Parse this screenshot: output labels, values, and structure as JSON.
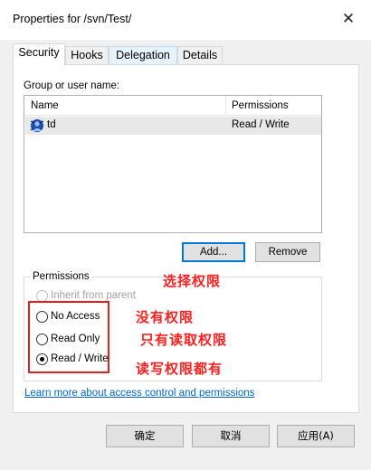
{
  "window": {
    "title": "Properties for /svn/Test/"
  },
  "tabs": [
    {
      "label": "Security"
    },
    {
      "label": "Hooks"
    },
    {
      "label": "Delegation"
    },
    {
      "label": "Details"
    }
  ],
  "security": {
    "group_label": "Group or user name:",
    "columns": [
      "Name",
      "Permissions"
    ],
    "rows": [
      {
        "name": "td",
        "permissions": "Read / Write"
      }
    ],
    "add_label": "Add...",
    "remove_label": "Remove",
    "permissions_legend": "Permissions",
    "radios": [
      {
        "label": "Inherit from parent",
        "enabled": false,
        "checked": false
      },
      {
        "label": "No Access",
        "enabled": true,
        "checked": false
      },
      {
        "label": "Read Only",
        "enabled": true,
        "checked": false
      },
      {
        "label": "Read / Write",
        "enabled": true,
        "checked": true
      }
    ],
    "learn_more": "Learn more about access control and permissions"
  },
  "annotations": {
    "select": "选择权限",
    "no_access": "没有权限",
    "read_only": "只有读取权限",
    "read_write": "读写权限都有",
    "color": "#ff1e1e"
  },
  "footer": {
    "ok": "确定",
    "cancel": "取消",
    "apply": "应用(A)"
  }
}
